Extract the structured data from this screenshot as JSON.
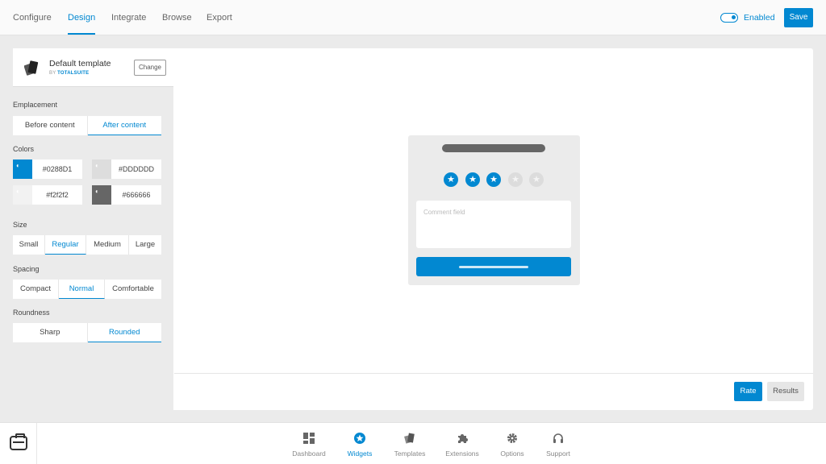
{
  "topnav": {
    "tabs": [
      {
        "label": "Configure",
        "active": false
      },
      {
        "label": "Design",
        "active": true
      },
      {
        "label": "Integrate",
        "active": false
      },
      {
        "label": "Browse",
        "active": false
      },
      {
        "label": "Export",
        "active": false
      }
    ],
    "enabled_label": "Enabled",
    "enabled_state": true,
    "save_label": "Save"
  },
  "template": {
    "name": "Default template",
    "by_prefix": "BY",
    "by_author": "TOTALSUITE",
    "change_label": "Change"
  },
  "sidebar": {
    "emplacement": {
      "label": "Emplacement",
      "options": [
        "Before content",
        "After content"
      ],
      "selected": "After content"
    },
    "colors": {
      "label": "Colors",
      "items": [
        {
          "value": "#0288D1",
          "swatch": "#0288d1"
        },
        {
          "value": "#DDDDDD",
          "swatch": "#dddddd"
        },
        {
          "value": "#f2f2f2",
          "swatch": "#f2f2f2"
        },
        {
          "value": "#666666",
          "swatch": "#666666"
        }
      ]
    },
    "size": {
      "label": "Size",
      "options": [
        "Small",
        "Regular",
        "Medium",
        "Large"
      ],
      "selected": "Regular"
    },
    "spacing": {
      "label": "Spacing",
      "options": [
        "Compact",
        "Normal",
        "Comfortable"
      ],
      "selected": "Normal"
    },
    "roundness": {
      "label": "Roundness",
      "options": [
        "Sharp",
        "Rounded"
      ],
      "selected": "Rounded"
    }
  },
  "preview": {
    "rating": 3,
    "max_rating": 5,
    "comment_placeholder": "Comment field",
    "rate_label": "Rate",
    "results_label": "Results"
  },
  "bottomnav": {
    "items": [
      {
        "label": "Dashboard",
        "icon": "dashboard-icon",
        "active": false
      },
      {
        "label": "Widgets",
        "icon": "star-icon",
        "active": true
      },
      {
        "label": "Templates",
        "icon": "templates-icon",
        "active": false
      },
      {
        "label": "Extensions",
        "icon": "puzzle-icon",
        "active": false
      },
      {
        "label": "Options",
        "icon": "gear-icon",
        "active": false
      },
      {
        "label": "Support",
        "icon": "headphones-icon",
        "active": false
      }
    ]
  },
  "colors": {
    "accent": "#0288d1",
    "background": "#ebebeb"
  }
}
